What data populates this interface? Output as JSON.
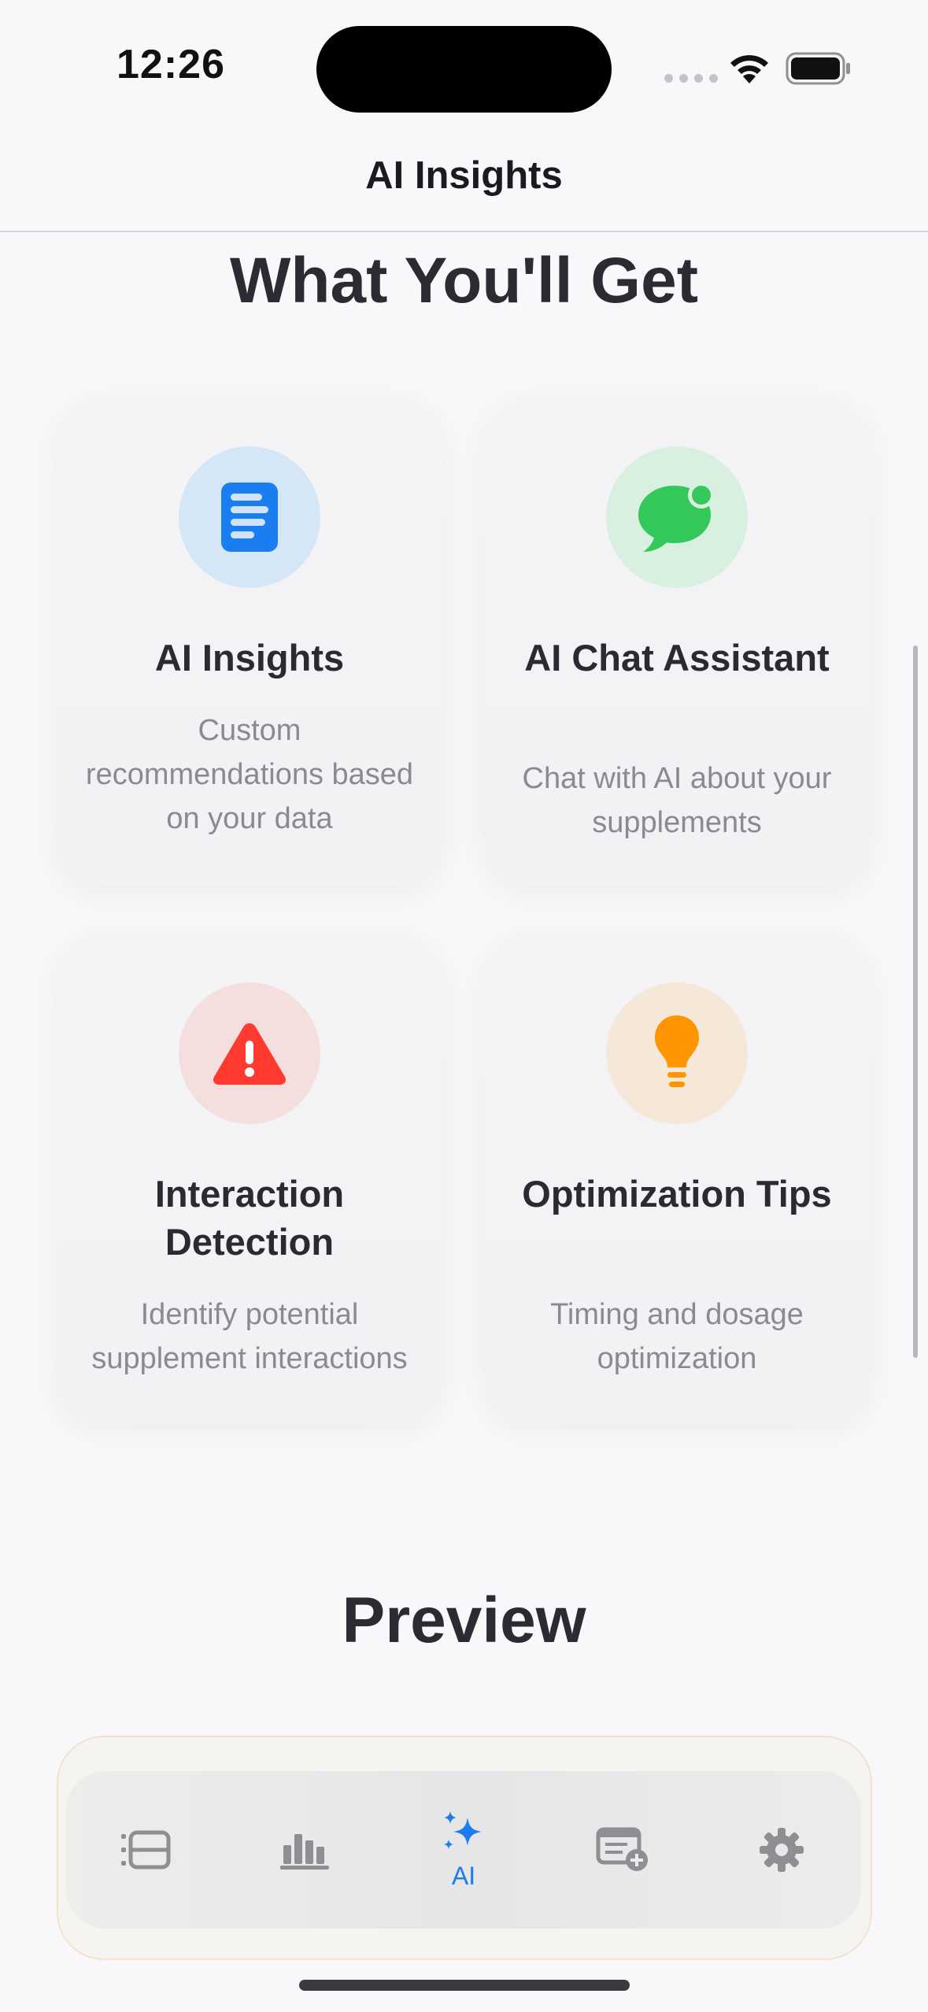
{
  "status_bar": {
    "time": "12:26"
  },
  "nav": {
    "title": "AI Insights"
  },
  "features_heading": "What You'll Get",
  "features": [
    {
      "title": "AI Insights",
      "description": "Custom recommendations based on your data",
      "icon": "document-list-icon",
      "icon_color": "#1a7df0",
      "icon_bg": "#d5e6f6"
    },
    {
      "title": "AI Chat Assistant",
      "description": "Chat with AI about your supplements",
      "icon": "chat-bubble-icon",
      "icon_color": "#34c759",
      "icon_bg": "#d9efe0"
    },
    {
      "title": "Interaction Detection",
      "description": "Identify potential supplement interactions",
      "icon": "warning-triangle-icon",
      "icon_color": "#ff3b30",
      "icon_bg": "#f5dede"
    },
    {
      "title": "Optimization Tips",
      "description": "Timing and dosage optimization",
      "icon": "lightbulb-icon",
      "icon_color": "#ff9500",
      "icon_bg": "#f5e8d8"
    }
  ],
  "preview_heading": "Preview",
  "tab_bar": {
    "tabs": [
      {
        "name": "list-icon",
        "label": ""
      },
      {
        "name": "chart-icon",
        "label": ""
      },
      {
        "name": "sparkles-icon",
        "label": "AI",
        "selected": true
      },
      {
        "name": "add-card-icon",
        "label": ""
      },
      {
        "name": "gear-icon",
        "label": ""
      }
    ],
    "accent": "#1b7cf0"
  }
}
